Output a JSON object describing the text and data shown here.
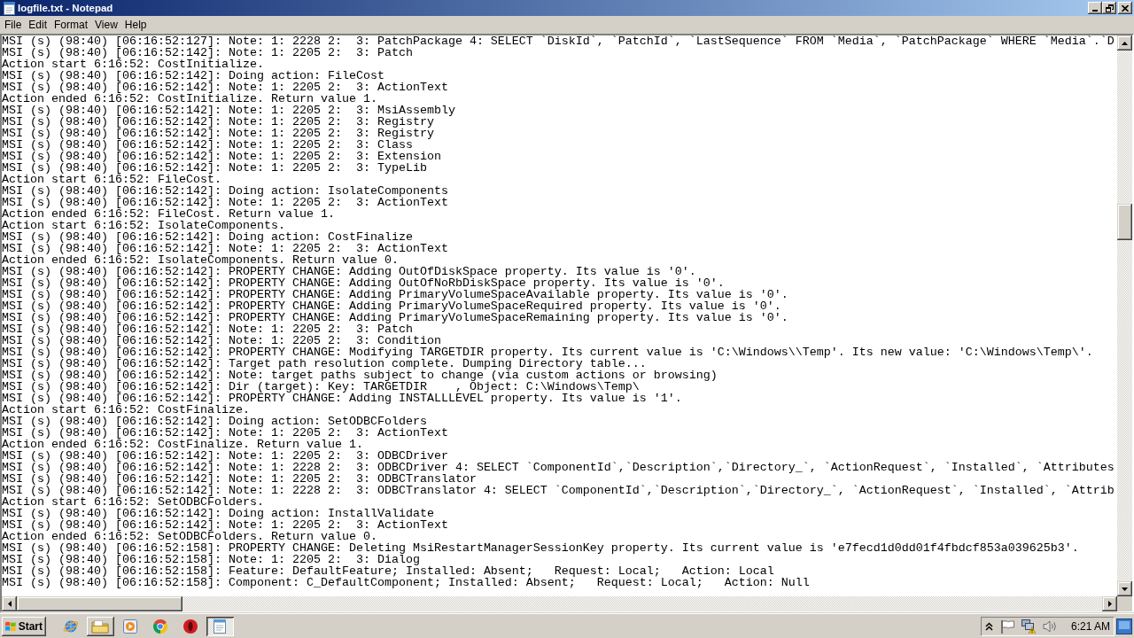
{
  "window": {
    "title": "logfile.txt - Notepad"
  },
  "menu": [
    "File",
    "Edit",
    "Format",
    "View",
    "Help"
  ],
  "editor": {
    "lines": [
      "MSI (s) (98:40) [06:16:52:127]: Note: 1: 2228 2:  3: PatchPackage 4: SELECT `DiskId`, `PatchId`, `LastSequence` FROM `Media`, `PatchPackage` WHERE `Media`.`D",
      "MSI (s) (98:40) [06:16:52:142]: Note: 1: 2205 2:  3: Patch",
      "Action start 6:16:52: CostInitialize.",
      "MSI (s) (98:40) [06:16:52:142]: Doing action: FileCost",
      "MSI (s) (98:40) [06:16:52:142]: Note: 1: 2205 2:  3: ActionText",
      "Action ended 6:16:52: CostInitialize. Return value 1.",
      "MSI (s) (98:40) [06:16:52:142]: Note: 1: 2205 2:  3: MsiAssembly",
      "MSI (s) (98:40) [06:16:52:142]: Note: 1: 2205 2:  3: Registry",
      "MSI (s) (98:40) [06:16:52:142]: Note: 1: 2205 2:  3: Registry",
      "MSI (s) (98:40) [06:16:52:142]: Note: 1: 2205 2:  3: Class",
      "MSI (s) (98:40) [06:16:52:142]: Note: 1: 2205 2:  3: Extension",
      "MSI (s) (98:40) [06:16:52:142]: Note: 1: 2205 2:  3: TypeLib",
      "Action start 6:16:52: FileCost.",
      "MSI (s) (98:40) [06:16:52:142]: Doing action: IsolateComponents",
      "MSI (s) (98:40) [06:16:52:142]: Note: 1: 2205 2:  3: ActionText",
      "Action ended 6:16:52: FileCost. Return value 1.",
      "Action start 6:16:52: IsolateComponents.",
      "MSI (s) (98:40) [06:16:52:142]: Doing action: CostFinalize",
      "MSI (s) (98:40) [06:16:52:142]: Note: 1: 2205 2:  3: ActionText",
      "Action ended 6:16:52: IsolateComponents. Return value 0.",
      "MSI (s) (98:40) [06:16:52:142]: PROPERTY CHANGE: Adding OutOfDiskSpace property. Its value is '0'.",
      "MSI (s) (98:40) [06:16:52:142]: PROPERTY CHANGE: Adding OutOfNoRbDiskSpace property. Its value is '0'.",
      "MSI (s) (98:40) [06:16:52:142]: PROPERTY CHANGE: Adding PrimaryVolumeSpaceAvailable property. Its value is '0'.",
      "MSI (s) (98:40) [06:16:52:142]: PROPERTY CHANGE: Adding PrimaryVolumeSpaceRequired property. Its value is '0'.",
      "MSI (s) (98:40) [06:16:52:142]: PROPERTY CHANGE: Adding PrimaryVolumeSpaceRemaining property. Its value is '0'.",
      "MSI (s) (98:40) [06:16:52:142]: Note: 1: 2205 2:  3: Patch",
      "MSI (s) (98:40) [06:16:52:142]: Note: 1: 2205 2:  3: Condition",
      "MSI (s) (98:40) [06:16:52:142]: PROPERTY CHANGE: Modifying TARGETDIR property. Its current value is 'C:\\Windows\\\\Temp'. Its new value: 'C:\\Windows\\Temp\\'.",
      "MSI (s) (98:40) [06:16:52:142]: Target path resolution complete. Dumping Directory table...",
      "MSI (s) (98:40) [06:16:52:142]: Note: target paths subject to change (via custom actions or browsing)",
      "MSI (s) (98:40) [06:16:52:142]: Dir (target): Key: TARGETDIR    , Object: C:\\Windows\\Temp\\",
      "MSI (s) (98:40) [06:16:52:142]: PROPERTY CHANGE: Adding INSTALLLEVEL property. Its value is '1'.",
      "Action start 6:16:52: CostFinalize.",
      "MSI (s) (98:40) [06:16:52:142]: Doing action: SetODBCFolders",
      "MSI (s) (98:40) [06:16:52:142]: Note: 1: 2205 2:  3: ActionText",
      "Action ended 6:16:52: CostFinalize. Return value 1.",
      "MSI (s) (98:40) [06:16:52:142]: Note: 1: 2205 2:  3: ODBCDriver",
      "MSI (s) (98:40) [06:16:52:142]: Note: 1: 2228 2:  3: ODBCDriver 4: SELECT `ComponentId`,`Description`,`Directory_`, `ActionRequest`, `Installed`, `Attributes",
      "MSI (s) (98:40) [06:16:52:142]: Note: 1: 2205 2:  3: ODBCTranslator",
      "MSI (s) (98:40) [06:16:52:142]: Note: 1: 2228 2:  3: ODBCTranslator 4: SELECT `ComponentId`,`Description`,`Directory_`, `ActionRequest`, `Installed`, `Attrib",
      "Action start 6:16:52: SetODBCFolders.",
      "MSI (s) (98:40) [06:16:52:142]: Doing action: InstallValidate",
      "MSI (s) (98:40) [06:16:52:142]: Note: 1: 2205 2:  3: ActionText",
      "Action ended 6:16:52: SetODBCFolders. Return value 0.",
      "MSI (s) (98:40) [06:16:52:158]: PROPERTY CHANGE: Deleting MsiRestartManagerSessionKey property. Its current value is 'e7fecd1d0dd01f4fbdcf853a039625b3'.",
      "MSI (s) (98:40) [06:16:52:158]: Note: 1: 2205 2:  3: Dialog",
      "MSI (s) (98:40) [06:16:52:158]: Feature: DefaultFeature; Installed: Absent;   Request: Local;   Action: Local",
      "MSI (s) (98:40) [06:16:52:158]: Component: C_DefaultComponent; Installed: Absent;   Request: Local;   Action: Null"
    ]
  },
  "taskbar": {
    "start": "Start",
    "items": [
      {
        "kind": "globe",
        "running": false,
        "selected": false
      },
      {
        "kind": "folder",
        "running": true,
        "selected": false
      },
      {
        "kind": "media",
        "running": false,
        "selected": false
      },
      {
        "kind": "segmented",
        "running": false,
        "selected": false
      },
      {
        "kind": "ring",
        "running": false,
        "selected": false
      },
      {
        "kind": "notepad",
        "running": true,
        "selected": true
      }
    ],
    "clock": "6:21 AM"
  }
}
